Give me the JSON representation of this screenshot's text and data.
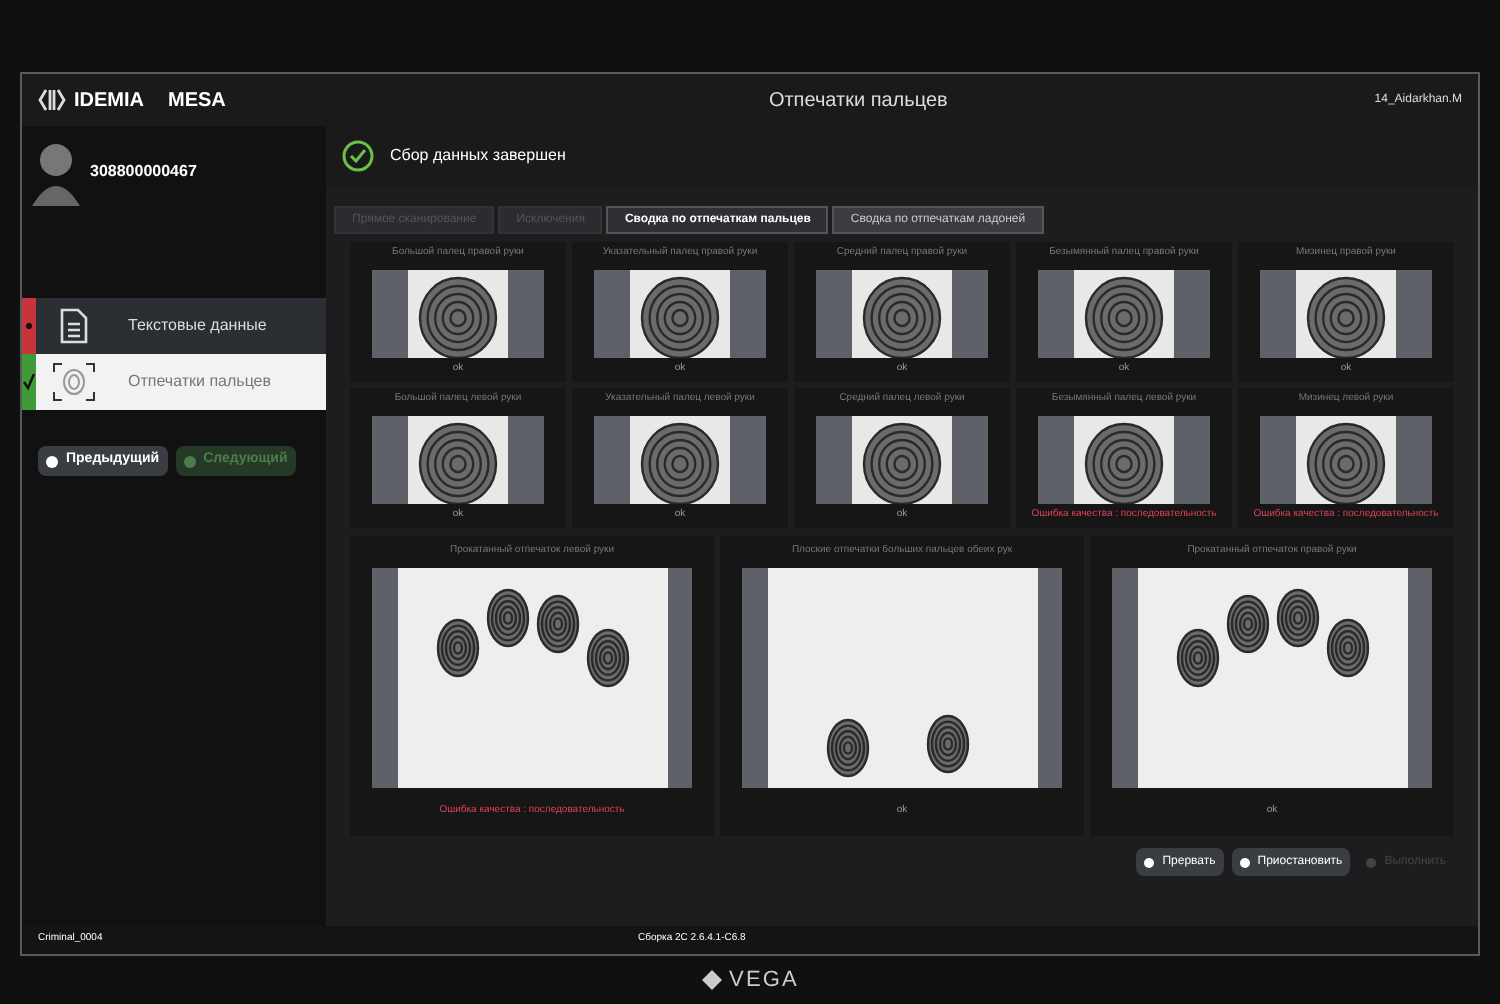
{
  "brand": {
    "company": "IDEMIA",
    "product": "MESA"
  },
  "window": {
    "title": "Отпечатки пальцев",
    "user": "14_Aidarkhan.M"
  },
  "subject": {
    "id": "308800000467"
  },
  "status": {
    "message": "Сбор данных завершен",
    "complete": true
  },
  "sidebar": {
    "items": [
      {
        "label": "Текстовые данные",
        "complete": false,
        "selected": false,
        "kind": "document"
      },
      {
        "label": "Отпечатки пальцев",
        "complete": true,
        "selected": true,
        "kind": "fingerprint"
      }
    ]
  },
  "nav_buttons": [
    {
      "label": "Предыдущий",
      "disabled": false
    },
    {
      "label": "Следующий",
      "disabled": true
    }
  ],
  "tabs": [
    {
      "label": "Прямое сканирование",
      "selected": false,
      "disabled": true
    },
    {
      "label": "Исключения",
      "selected": false,
      "disabled": true
    },
    {
      "label": "Сводка по отпечаткам пальцев",
      "selected": true,
      "disabled": false
    },
    {
      "label": "Сводка по отпечаткам ладоней",
      "selected": false,
      "disabled": false
    }
  ],
  "fingers": [
    {
      "label": "Большой палец правой руки",
      "result": "ok",
      "kind": "ok"
    },
    {
      "label": "Указательный палец правой руки",
      "result": "ok",
      "kind": "ok"
    },
    {
      "label": "Средний палец правой руки",
      "result": "ok",
      "kind": "ok"
    },
    {
      "label": "Безымянный палец правой руки",
      "result": "ok",
      "kind": "ok"
    },
    {
      "label": "Мизинец правой руки",
      "result": "ok",
      "kind": "ok"
    },
    {
      "label": "Большой палец левой руки",
      "result": "ok",
      "kind": "ok"
    },
    {
      "label": "Указательный палец левой руки",
      "result": "ok",
      "kind": "ok"
    },
    {
      "label": "Средний палец левой руки",
      "result": "ok",
      "kind": "ok"
    },
    {
      "label": "Безымянный палец левой руки",
      "result": "Ошибка качества : последовательность",
      "kind": "error"
    },
    {
      "label": "Мизинец левой руки",
      "result": "Ошибка качества : последовательность",
      "kind": "error"
    }
  ],
  "slaps": [
    {
      "label": "Прокатанный отпечаток левой руки",
      "result": "Ошибка качества : последовательность",
      "error": true,
      "kind": "left"
    },
    {
      "label": "Плоские отпечатки больших пальцев обеих рук",
      "result": "ok",
      "error": false,
      "kind": "thumbs"
    },
    {
      "label": "Прокатанный отпечаток правой руки",
      "result": "ok",
      "error": false,
      "kind": "right"
    }
  ],
  "action_buttons": [
    {
      "label": "Прервать",
      "disabled": false
    },
    {
      "label": "Приостановить",
      "disabled": false
    },
    {
      "label": "Выполнить",
      "disabled": true
    }
  ],
  "footer": {
    "build": "Сборка 2С 2.6.4.1-С6.8",
    "workstation": "Criminal_0004"
  },
  "monitor": {
    "brand": "VEGA"
  }
}
